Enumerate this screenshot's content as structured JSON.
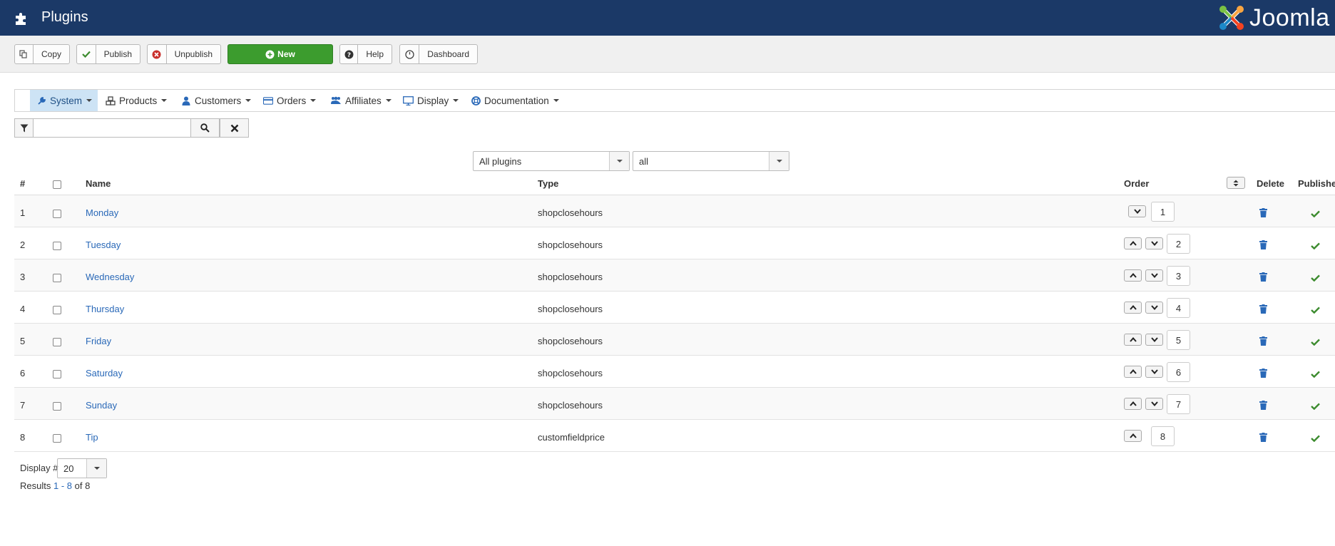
{
  "header": {
    "title": "Plugins",
    "brand": "Joomla"
  },
  "toolbar": {
    "copy": "Copy",
    "publish": "Publish",
    "unpublish": "Unpublish",
    "new": "New",
    "help": "Help",
    "dashboard": "Dashboard"
  },
  "menu": {
    "items": [
      {
        "label": "System",
        "icon": "wrench-icon"
      },
      {
        "label": "Products",
        "icon": "cubes-icon"
      },
      {
        "label": "Customers",
        "icon": "user-icon"
      },
      {
        "label": "Orders",
        "icon": "credit-card-icon"
      },
      {
        "label": "Affiliates",
        "icon": "users-icon"
      },
      {
        "label": "Display",
        "icon": "monitor-icon"
      },
      {
        "label": "Documentation",
        "icon": "life-ring-icon"
      }
    ]
  },
  "search": {
    "value": ""
  },
  "filters": {
    "plugin_group": "All plugins",
    "status": "all"
  },
  "table": {
    "headers": {
      "num": "#",
      "name": "Name",
      "type": "Type",
      "order": "Order",
      "delete": "Delete",
      "published": "Publishe"
    },
    "rows": [
      {
        "num": "1",
        "name": "Monday",
        "type": "shopclosehours",
        "order": "1"
      },
      {
        "num": "2",
        "name": "Tuesday",
        "type": "shopclosehours",
        "order": "2"
      },
      {
        "num": "3",
        "name": "Wednesday",
        "type": "shopclosehours",
        "order": "3"
      },
      {
        "num": "4",
        "name": "Thursday",
        "type": "shopclosehours",
        "order": "4"
      },
      {
        "num": "5",
        "name": "Friday",
        "type": "shopclosehours",
        "order": "5"
      },
      {
        "num": "6",
        "name": "Saturday",
        "type": "shopclosehours",
        "order": "6"
      },
      {
        "num": "7",
        "name": "Sunday",
        "type": "shopclosehours",
        "order": "7"
      },
      {
        "num": "8",
        "name": "Tip",
        "type": "customfieldprice",
        "order": "8"
      }
    ]
  },
  "pagination": {
    "display_label": "Display #",
    "display_value": "20",
    "results_prefix": "Results",
    "results_range": "1 - 8",
    "results_suffix": "of 8"
  },
  "colors": {
    "header_bg": "#1b3967",
    "new_button": "#3c9c2e",
    "link": "#2a69b8",
    "active_menu": "#cde3f5",
    "publish_check": "#3c8b2e",
    "trash": "#2a69b8"
  }
}
